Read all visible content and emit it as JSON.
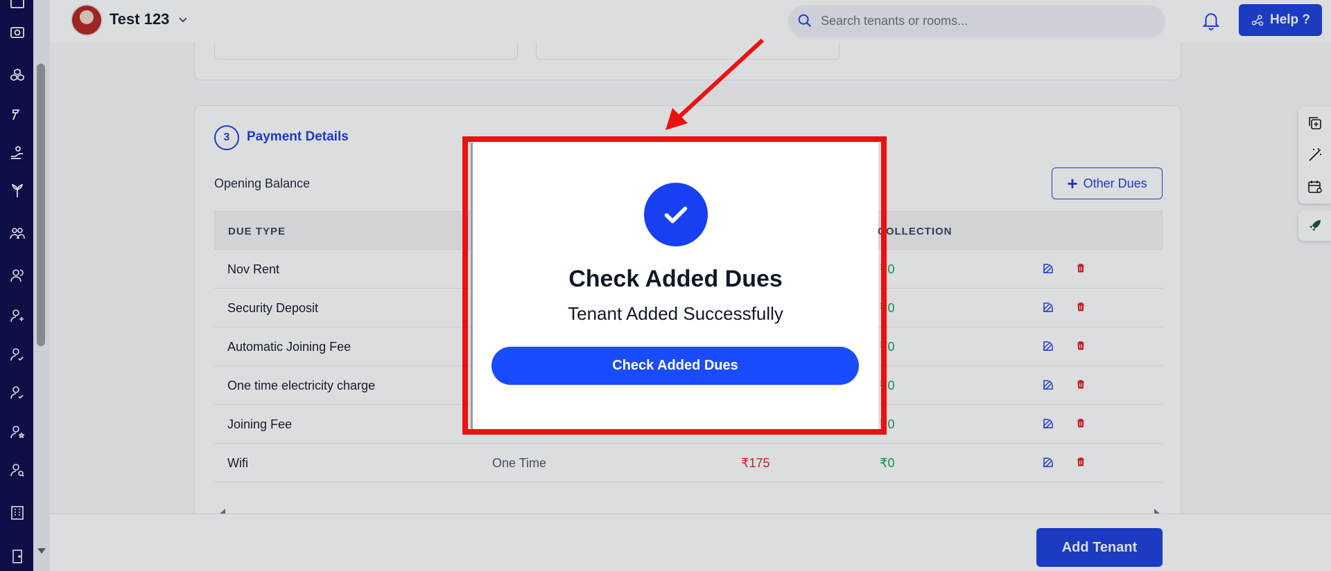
{
  "app": {
    "property_name": "Test 123",
    "search_placeholder": "Search tenants or rooms...",
    "help_label": "Help ?"
  },
  "leftnav": {
    "icons": [
      "dashboard-icon",
      "camera-icon",
      "cubes-icon",
      "gavel-icon",
      "hand-money-icon",
      "plant-icon",
      "group-icon",
      "users-icon",
      "user-add-icon",
      "user-check-icon",
      "user-check-alt-icon",
      "user-star-icon",
      "user-search-icon",
      "building-icon",
      "door-icon"
    ]
  },
  "section": {
    "step": "3",
    "title": "Payment Details",
    "opening_balance_label": "Opening Balance",
    "other_dues_label": "Other Dues"
  },
  "table": {
    "headers": {
      "due_type": "DUE TYPE",
      "collection": "COLLECTION"
    },
    "rows": [
      {
        "name": "Nov Rent",
        "frequency": "",
        "amount": "",
        "collection": "₹0"
      },
      {
        "name": "Security Deposit",
        "frequency": "",
        "amount": "",
        "collection": "₹0"
      },
      {
        "name": "Automatic Joining Fee",
        "frequency": "",
        "amount": "",
        "collection": "₹0"
      },
      {
        "name": "One time electricity charge",
        "frequency": "",
        "amount": "",
        "collection": "₹0"
      },
      {
        "name": "Joining Fee",
        "frequency": "",
        "amount": "",
        "collection": "₹0"
      },
      {
        "name": "Wifi",
        "frequency": "One Time",
        "amount": "₹175",
        "collection": "₹0"
      }
    ]
  },
  "footer": {
    "add_tenant_label": "Add Tenant"
  },
  "modal": {
    "title": "Check Added Dues",
    "subtitle": "Tenant Added Successfully",
    "button_label": "Check Added Dues"
  },
  "colors": {
    "primary": "#1a3fdc",
    "nav_bg": "#0b0a4a",
    "highlight_frame": "#ee1010",
    "amount_red": "#dc2626",
    "collection_green": "#16a34a"
  }
}
